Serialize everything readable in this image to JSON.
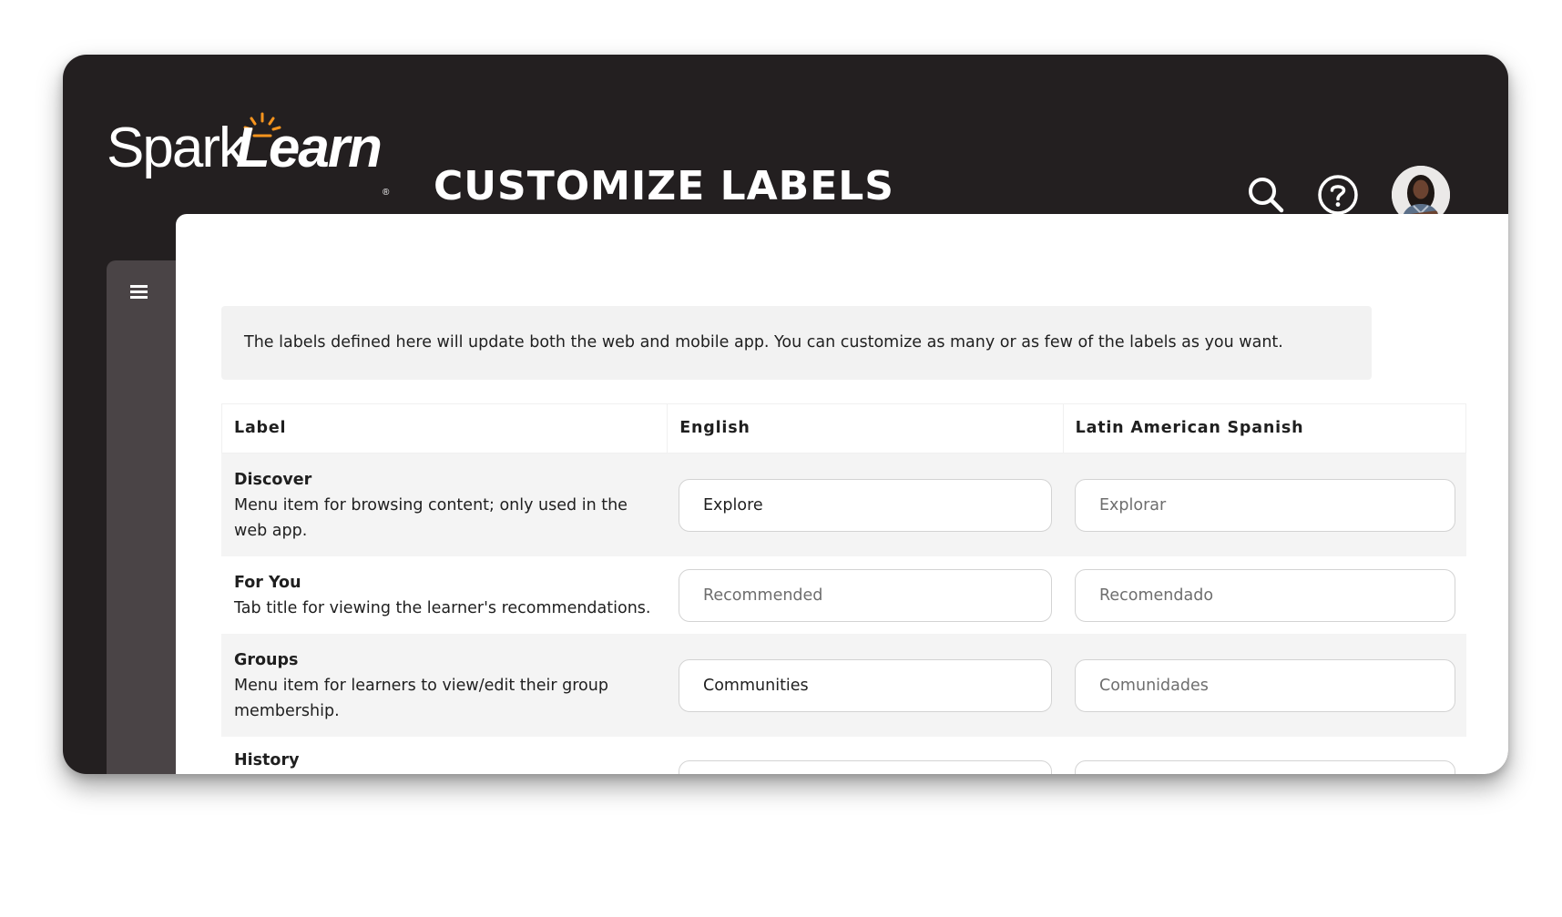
{
  "app": {
    "logo_text_1": "Spark",
    "logo_text_2": "Learn",
    "logo_mark": "®",
    "page_title": "CUSTOMIZE LABELS",
    "accent_color": "#f7941d",
    "header_bg": "#231f20",
    "sidebar_bg": "#4a4446"
  },
  "header": {
    "icons": [
      "search-icon",
      "help-icon",
      "avatar"
    ]
  },
  "sidebar": {
    "menu_icon": "hamburger-menu-icon"
  },
  "info": {
    "text": "The labels defined here will update both the web and mobile app. You can customize as many or as few of the labels as you want."
  },
  "table": {
    "headers": [
      "Label",
      "English",
      "Latin American Spanish"
    ],
    "rows": [
      {
        "name": "Discover",
        "description": "Menu item for browsing content; only used in the web app.",
        "english_value": "Explore",
        "english_placeholder": "",
        "spanish_value": "",
        "spanish_placeholder": "Explorar"
      },
      {
        "name": "For You",
        "description": "Tab title for viewing the learner's recommendations.",
        "english_value": "",
        "english_placeholder": "Recommended",
        "spanish_value": "",
        "spanish_placeholder": "Recomendado"
      },
      {
        "name": "Groups",
        "description": "Menu item for learners to view/edit their group membership.",
        "english_value": "Communities",
        "english_placeholder": "",
        "spanish_value": "",
        "spanish_placeholder": "Comunidades"
      },
      {
        "name": "History",
        "description": "",
        "english_value": "",
        "english_placeholder": "",
        "spanish_value": "",
        "spanish_placeholder": ""
      }
    ]
  }
}
